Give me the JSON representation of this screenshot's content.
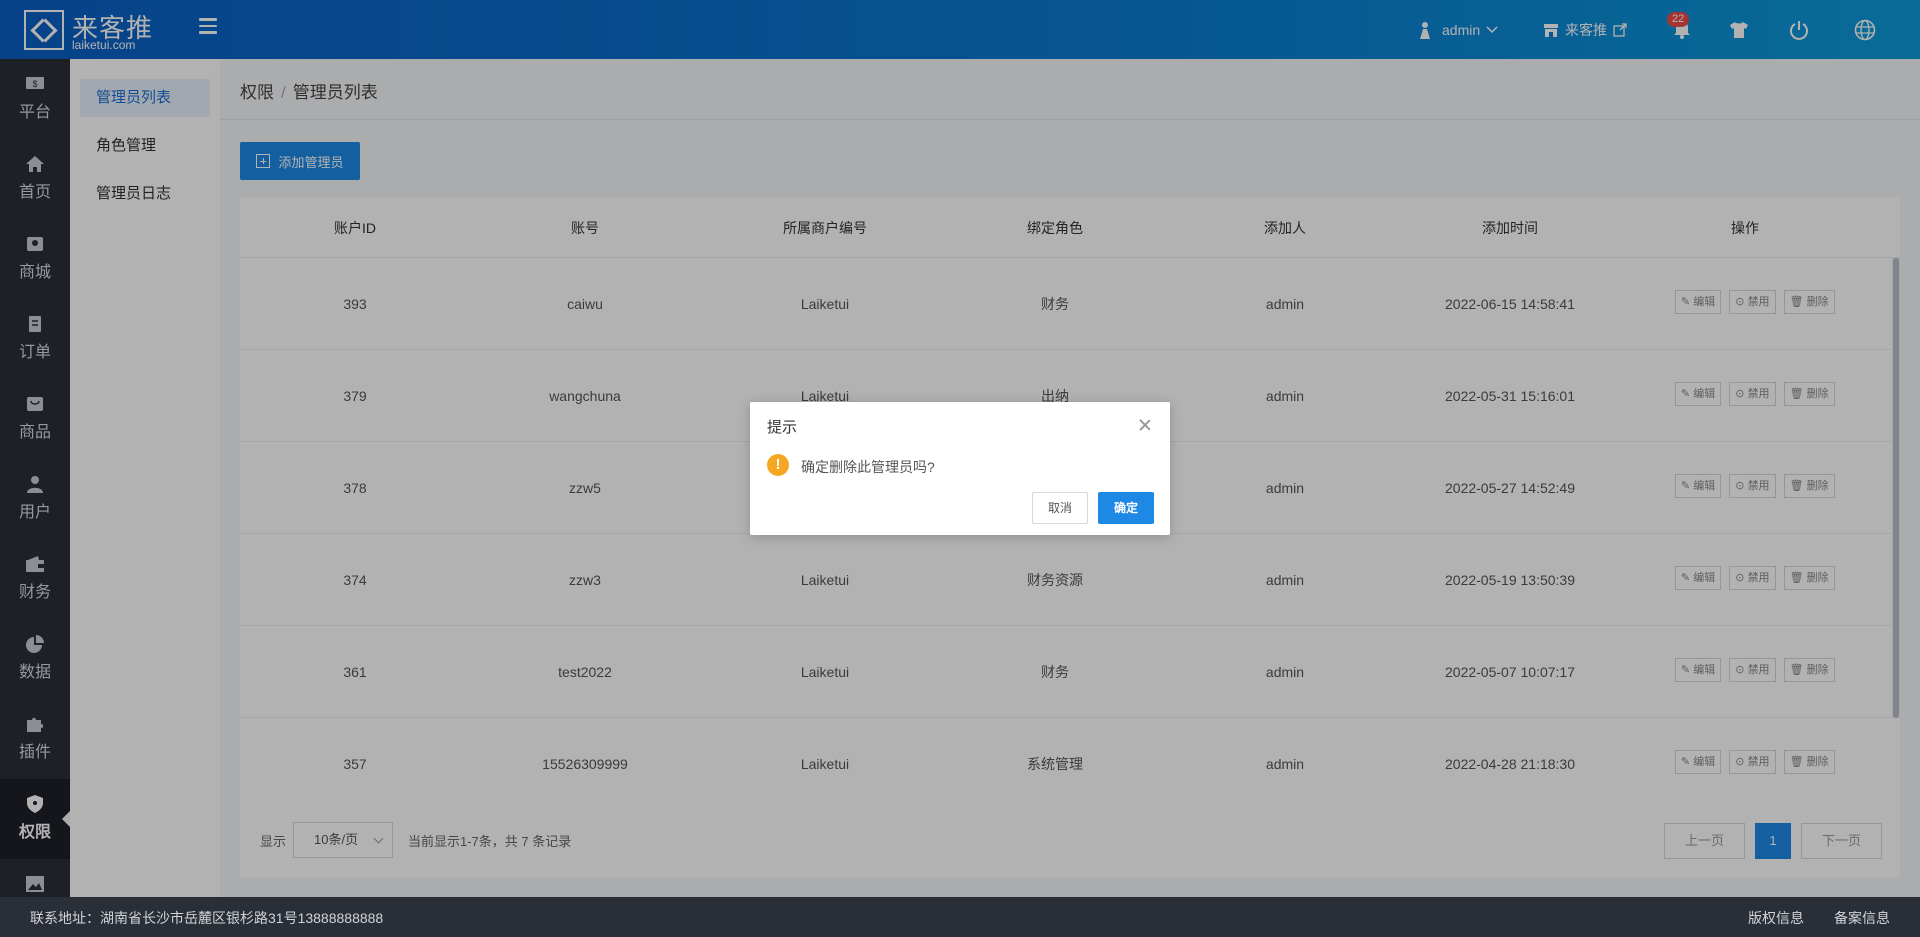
{
  "brand": {
    "name_cn": "来客推",
    "name_en": "laiketui.com"
  },
  "topbar": {
    "user": "admin",
    "store": "来客推",
    "notification_count": "22",
    "icons": [
      "menu-icon",
      "user-icon",
      "store-icon",
      "external-link-icon",
      "bell-icon",
      "shirt-icon",
      "power-icon",
      "globe-icon"
    ]
  },
  "sidebar": {
    "items": [
      {
        "label": "平台",
        "icon": "platform-icon"
      },
      {
        "label": "首页",
        "icon": "home-icon"
      },
      {
        "label": "商城",
        "icon": "mall-icon"
      },
      {
        "label": "订单",
        "icon": "order-icon"
      },
      {
        "label": "商品",
        "icon": "goods-icon"
      },
      {
        "label": "用户",
        "icon": "user-icon"
      },
      {
        "label": "财务",
        "icon": "wallet-icon"
      },
      {
        "label": "数据",
        "icon": "pie-chart-icon"
      },
      {
        "label": "插件",
        "icon": "puzzle-icon"
      },
      {
        "label": "权限",
        "icon": "shield-icon",
        "active": true
      },
      {
        "label": "",
        "icon": "image-icon"
      }
    ]
  },
  "submenu": {
    "items": [
      {
        "label": "管理员列表",
        "active": true
      },
      {
        "label": "角色管理"
      },
      {
        "label": "管理员日志"
      }
    ]
  },
  "breadcrumb": {
    "parent": "权限",
    "separator": "/",
    "current": "管理员列表"
  },
  "toolbar": {
    "add_label": "添加管理员"
  },
  "table": {
    "headers": [
      "账户ID",
      "账号",
      "所属商户编号",
      "绑定角色",
      "添加人",
      "添加时间",
      "操作"
    ],
    "rows": [
      {
        "id": "393",
        "account": "caiwu",
        "merchant": "Laiketui",
        "role": "财务",
        "creator": "admin",
        "time": "2022-06-15 14:58:41"
      },
      {
        "id": "379",
        "account": "wangchuna",
        "merchant": "Laiketui",
        "role": "出纳",
        "creator": "admin",
        "time": "2022-05-31 15:16:01"
      },
      {
        "id": "378",
        "account": "zzw5",
        "merchant": "",
        "role": "",
        "creator": "admin",
        "time": "2022-05-27 14:52:49"
      },
      {
        "id": "374",
        "account": "zzw3",
        "merchant": "Laiketui",
        "role": "财务资源",
        "creator": "admin",
        "time": "2022-05-19 13:50:39"
      },
      {
        "id": "361",
        "account": "test2022",
        "merchant": "Laiketui",
        "role": "财务",
        "creator": "admin",
        "time": "2022-05-07 10:07:17"
      },
      {
        "id": "357",
        "account": "15526309999",
        "merchant": "Laiketui",
        "role": "系统管理",
        "creator": "admin",
        "time": "2022-04-28 21:18:30"
      }
    ],
    "actions": {
      "edit": "编辑",
      "disable": "禁用",
      "delete": "删除"
    }
  },
  "pager": {
    "show_label": "显示",
    "page_size": "10条/页",
    "summary": "当前显示1-7条，共 7 条记录",
    "prev": "上一页",
    "current": "1",
    "next": "下一页"
  },
  "footer": {
    "address": "联系地址：湖南省长沙市岳麓区银杉路31号13888888888",
    "copyright": "版权信息",
    "beian": "备案信息"
  },
  "dialog": {
    "title": "提示",
    "message": "确定删除此管理员吗?",
    "cancel": "取消",
    "confirm": "确定"
  },
  "colors": {
    "primary": "#1e88e5",
    "topbar": "#0a7bd2",
    "sidebar": "#2a2e36",
    "warning": "#f5a623",
    "badge": "#f04848"
  }
}
